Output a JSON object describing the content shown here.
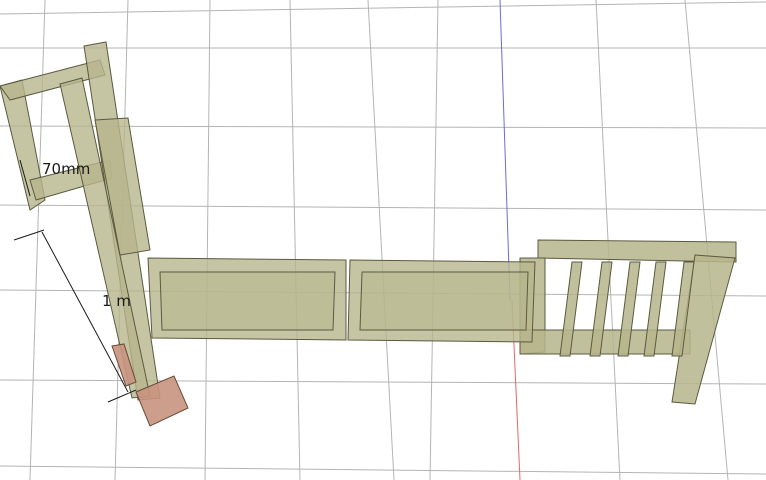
{
  "scene": {
    "background": "#ffffff",
    "grid_color": "#b4b4b4",
    "axis_x_color": "#e06a6a",
    "axis_y_color": "#6a6ae0",
    "wood_color": "#b6b58c",
    "wood_edge_color": "#5b5a40",
    "highlight_color": "#c8947f"
  },
  "dimensions": [
    {
      "label": "70mm"
    },
    {
      "label": "1  m"
    }
  ]
}
